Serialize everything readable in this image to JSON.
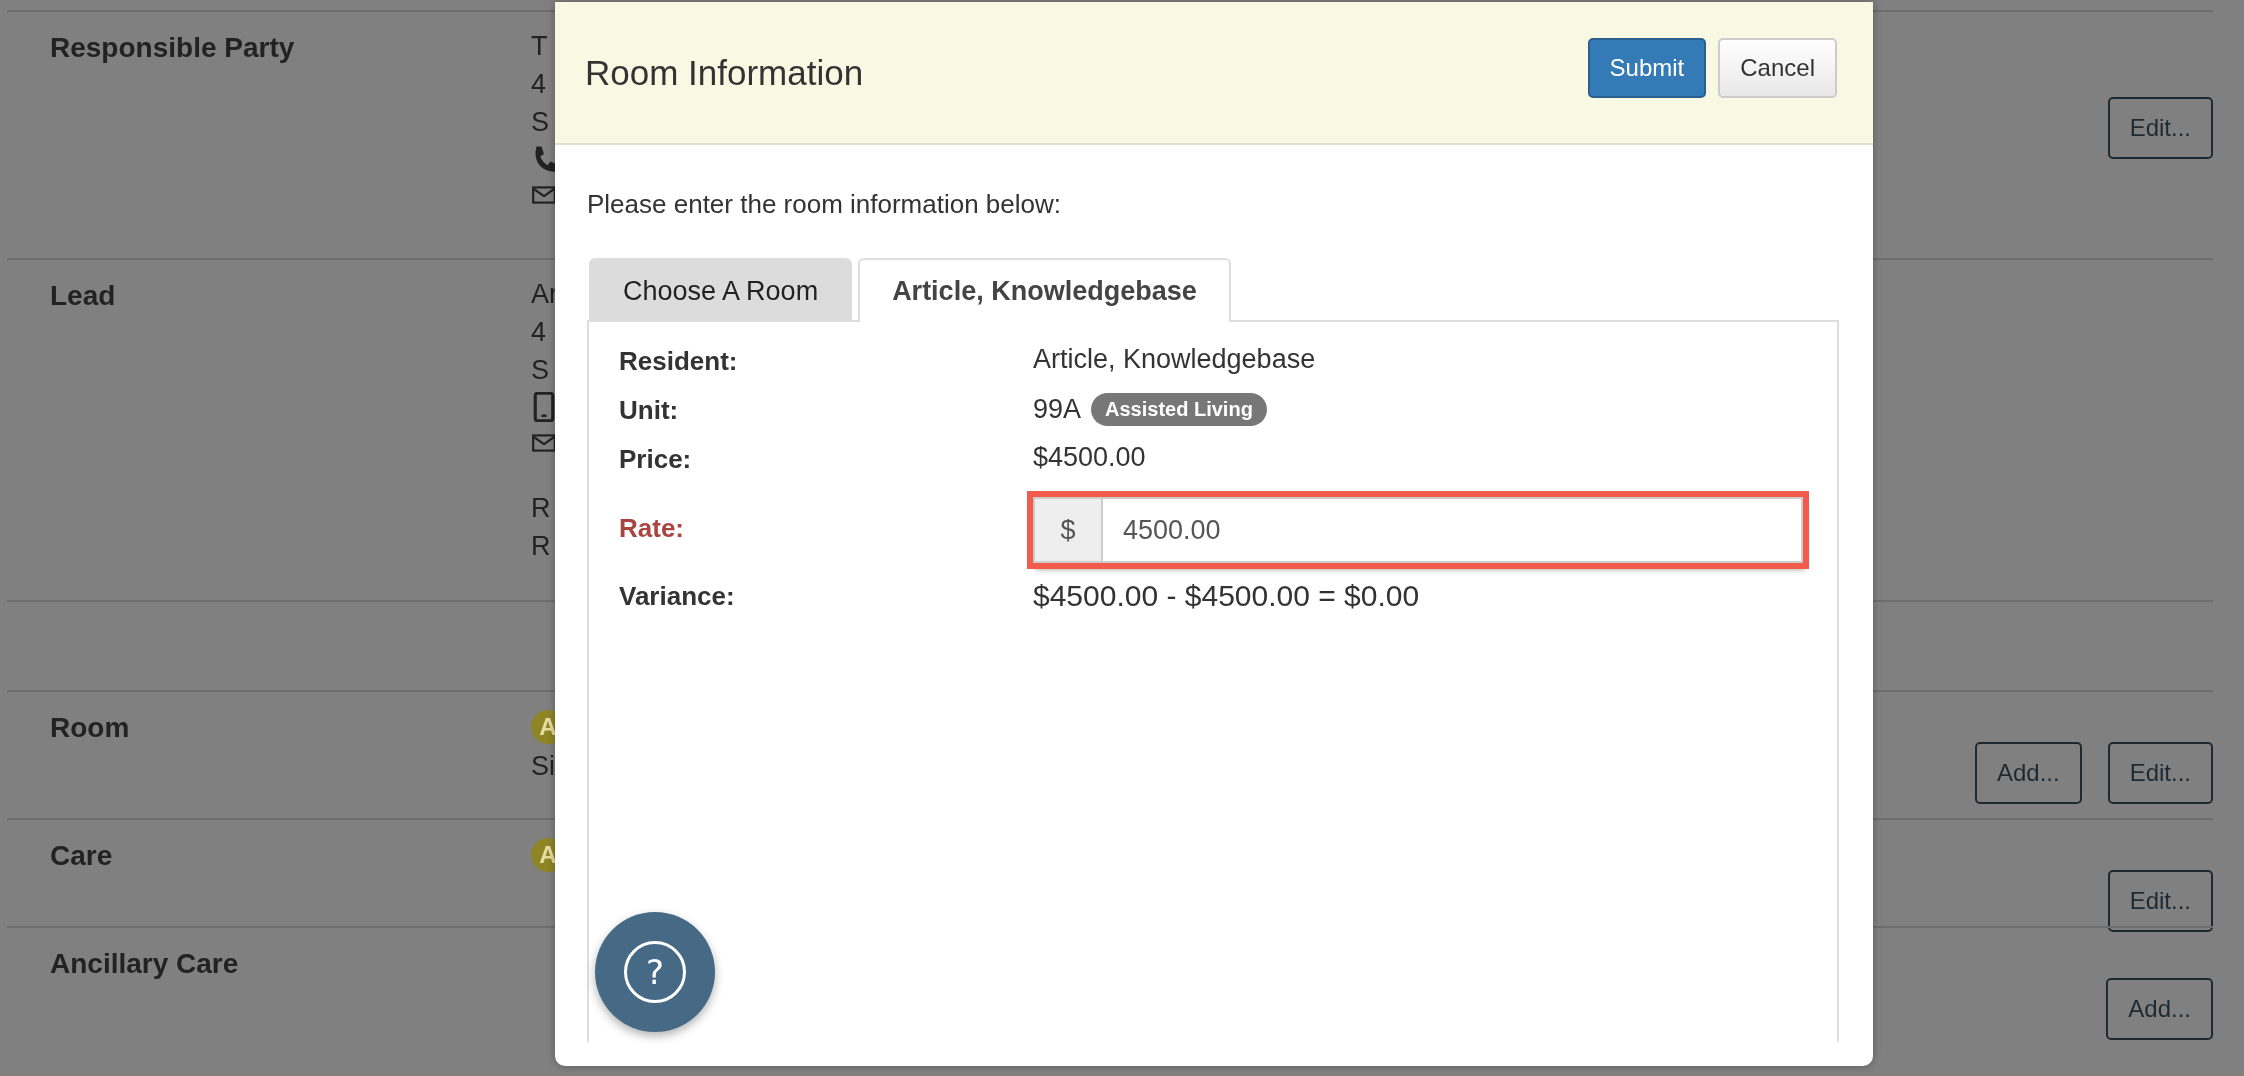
{
  "background": {
    "sections": [
      {
        "label": "Responsible Party",
        "lines": [
          {
            "kind": "text",
            "text": "T"
          },
          {
            "kind": "text",
            "text": "4"
          },
          {
            "kind": "text",
            "text": "S"
          },
          {
            "kind": "phone"
          },
          {
            "kind": "mail"
          }
        ],
        "buttons": [
          "Edit..."
        ]
      },
      {
        "label": "Lead",
        "lines": [
          {
            "kind": "text",
            "text": "Ar"
          },
          {
            "kind": "text",
            "text": "4"
          },
          {
            "kind": "text",
            "text": "S"
          },
          {
            "kind": "mobile"
          },
          {
            "kind": "mail"
          },
          {
            "kind": "gap"
          },
          {
            "kind": "text",
            "text": "R"
          },
          {
            "kind": "text",
            "text": "R"
          }
        ]
      },
      {
        "label": "Room",
        "lines": [
          {
            "kind": "badge",
            "text": "A"
          },
          {
            "kind": "text",
            "text": "Si"
          }
        ],
        "buttons": [
          "Add...",
          "Edit..."
        ]
      },
      {
        "label": "Care",
        "lines": [
          {
            "kind": "badge",
            "text": "A"
          }
        ],
        "buttons": [
          "Edit..."
        ]
      },
      {
        "label": "Ancillary Care",
        "buttons": [
          "Add..."
        ]
      }
    ]
  },
  "modal": {
    "title": "Room Information",
    "buttons": [
      {
        "label": "Submit",
        "kind": "primary"
      },
      {
        "label": "Cancel",
        "kind": "default"
      }
    ],
    "intro": "Please enter the room information below:",
    "tabs": [
      {
        "label": "Choose A Room",
        "selected": false
      },
      {
        "label": "Article, Knowledgebase",
        "selected": true
      }
    ],
    "fields": [
      {
        "kind": "text",
        "label": "Resident:",
        "value": "Article, Knowledgebase"
      },
      {
        "kind": "badge",
        "label": "Unit:",
        "value": "99A",
        "badge": "Assisted Living"
      },
      {
        "kind": "text",
        "label": "Price:",
        "value": "$4500.00"
      },
      {
        "kind": "input",
        "label": "Rate:",
        "prefix": "$",
        "value": "4500.00",
        "highlighted": true
      },
      {
        "kind": "text",
        "label": "Variance:",
        "value": "$4500.00 - $4500.00 = $0.00"
      }
    ]
  },
  "help_button": {
    "symbol": "?"
  }
}
